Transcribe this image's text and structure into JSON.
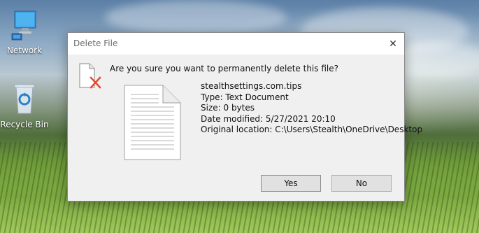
{
  "desktop": {
    "icons": [
      {
        "label": "Network",
        "icon": "network-icon"
      },
      {
        "label": "Recycle Bin",
        "icon": "recycle-bin-icon"
      }
    ]
  },
  "dialog": {
    "title": "Delete File",
    "close_glyph": "✕",
    "question": "Are you sure you want to permanently delete this file?",
    "file": {
      "name": "stealthsettings.com.tips",
      "type": "Type: Text Document",
      "size": "Size: 0 bytes",
      "date_modified": "Date modified: 5/27/2021 20:10",
      "original_location": "Original location: C:\\Users\\Stealth\\OneDrive\\Desktop"
    },
    "buttons": {
      "yes": "Yes",
      "no": "No"
    }
  },
  "colors": {
    "dialog_bg": "#f0f0f0",
    "titlebar_bg": "#ffffff",
    "warning_red": "#e04a2a",
    "button_bg": "#e1e1e1"
  }
}
